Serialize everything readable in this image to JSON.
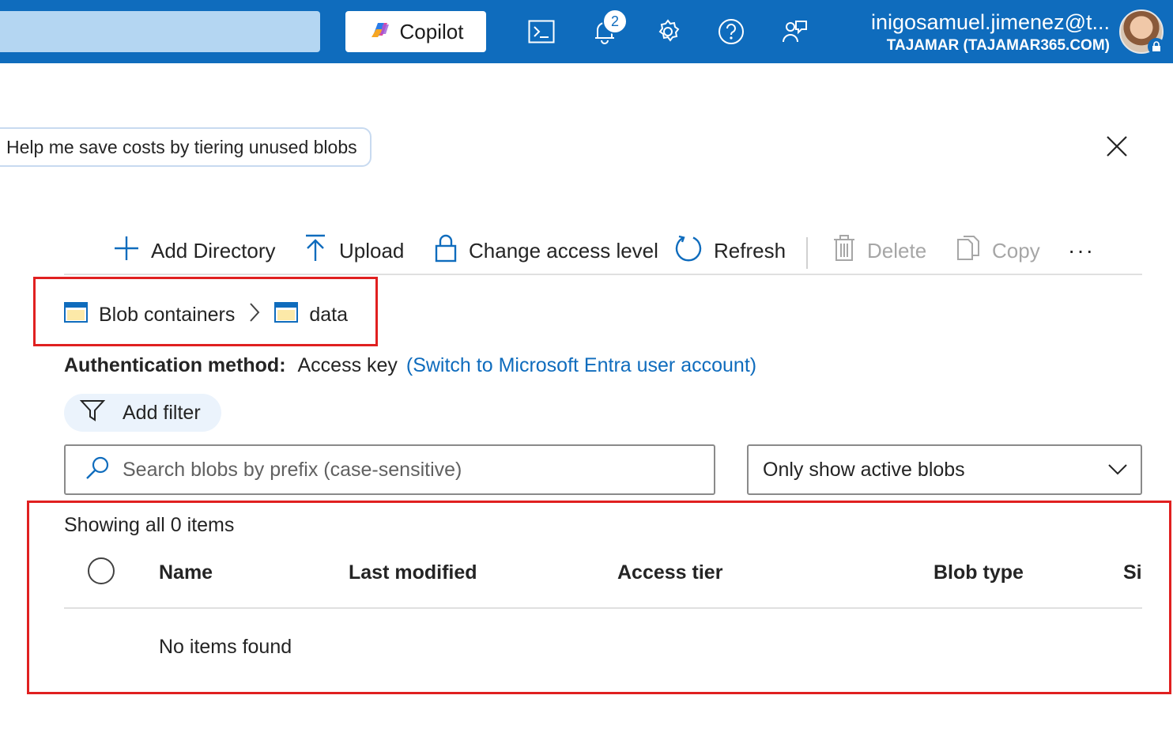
{
  "topbar": {
    "copilot_label": "Copilot",
    "notification_count": "2",
    "account_email": "inigosamuel.jimenez@t...",
    "account_tenant": "TAJAMAR (TAJAMAR365.COM)",
    "brand_color": "#0f6cbd"
  },
  "suggestion": "Help me save costs by tiering unused blobs",
  "toolbar": {
    "add_directory": "Add Directory",
    "upload": "Upload",
    "change_access": "Change access level",
    "refresh": "Refresh",
    "delete": "Delete",
    "copy": "Copy",
    "more": "···"
  },
  "breadcrumb": {
    "root": "Blob containers",
    "current": "data"
  },
  "auth": {
    "label": "Authentication method:",
    "value": "Access key",
    "switch_link": "(Switch to Microsoft Entra user account)"
  },
  "filter": {
    "add_filter": "Add filter"
  },
  "search": {
    "placeholder": "Search blobs by prefix (case-sensitive)",
    "value": ""
  },
  "blob_state_dropdown": {
    "selected": "Only show active blobs"
  },
  "list": {
    "count_text": "Showing all 0 items",
    "columns": [
      "Name",
      "Last modified",
      "Access tier",
      "Blob type",
      "Size"
    ],
    "empty_text": "No items found"
  },
  "highlight_color": "#e02020"
}
